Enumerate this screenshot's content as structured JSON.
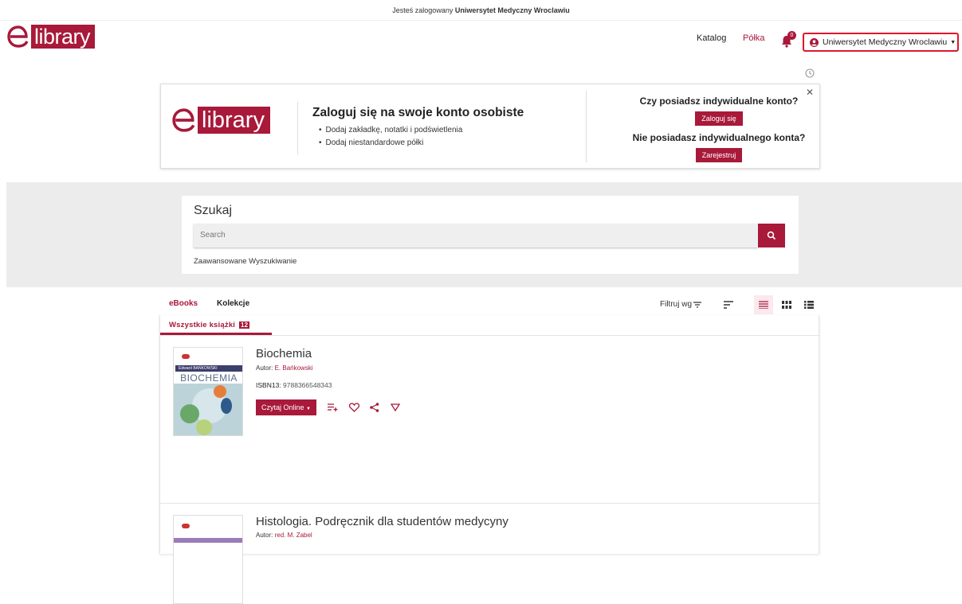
{
  "topbar": {
    "prefix": "Jesteś zalogowany",
    "org": "Uniwersytet Medyczny Wroclawiu"
  },
  "logo": {
    "text": "library"
  },
  "nav": {
    "catalog": "Katalog",
    "shelf": "Półka",
    "notif_count": "0",
    "user": "Uniwersytet Medyczny Wroclawiu"
  },
  "promo": {
    "logo_text": "library",
    "title": "Zaloguj się na swoje konto osobiste",
    "bullets": [
      "Dodaj zakładkę, notatki i podświetlenia",
      "Dodaj niestandardowe półki"
    ],
    "q1": "Czy posiadsz indywidualne konto?",
    "login_btn": "Zaloguj się",
    "q2": "Nie posiadasz indywidualnego konta?",
    "register_btn": "Zarejestruj"
  },
  "search": {
    "label": "Szukaj",
    "placeholder": "Search",
    "advanced": "Zaawansowane Wyszukiwanie"
  },
  "tabs": {
    "ebooks": "eBooks",
    "collections": "Kolekcje",
    "filter": "Filtruj wg"
  },
  "subtab": {
    "label": "Wszystkie książki",
    "count": "12"
  },
  "books": [
    {
      "title": "Biochemia",
      "author_prefix": "Autor:",
      "author": "E. Bańkowski",
      "isbn_label": "ISBN13",
      "isbn": "9788366548343",
      "read_btn": "Czytaj Online",
      "cover_author": "Edward BAŃKOWSKI",
      "cover_title": "BIOCHEMIA"
    },
    {
      "title": "Histologia. Podręcznik dla studentów medycyny",
      "author_prefix": "Autor:",
      "author": "red. M. Zabel"
    }
  ],
  "colors": {
    "accent": "#a8193a",
    "highlight": "#e0162b"
  }
}
